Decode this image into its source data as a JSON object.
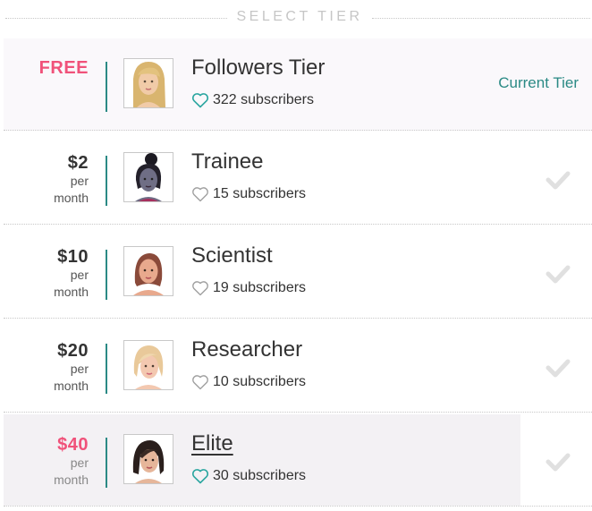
{
  "header": {
    "title": "SELECT TIER"
  },
  "colors": {
    "accent_teal": "#2b8a85",
    "accent_pink": "#f0527a",
    "check_gray": "#e0e0e0"
  },
  "tiers": [
    {
      "price": "FREE",
      "period_1": "",
      "period_2": "",
      "name": "Followers Tier",
      "subscribers": "322 subscribers",
      "status": "Current Tier",
      "avatar": "blonde-long-hair-avatar"
    },
    {
      "price": "$2",
      "period_1": "per",
      "period_2": "month",
      "name": "Trainee",
      "subscribers": "15 subscribers",
      "avatar": "dark-hair-bun-avatar"
    },
    {
      "price": "$10",
      "period_1": "per",
      "period_2": "month",
      "name": "Scientist",
      "subscribers": "19 subscribers",
      "avatar": "auburn-hair-avatar"
    },
    {
      "price": "$20",
      "period_1": "per",
      "period_2": "month",
      "name": "Researcher",
      "subscribers": "10 subscribers",
      "avatar": "blonde-bob-avatar"
    },
    {
      "price": "$40",
      "period_1": "per",
      "period_2": "month",
      "name": "Elite",
      "subscribers": "30 subscribers",
      "avatar": "dark-bob-avatar"
    }
  ]
}
